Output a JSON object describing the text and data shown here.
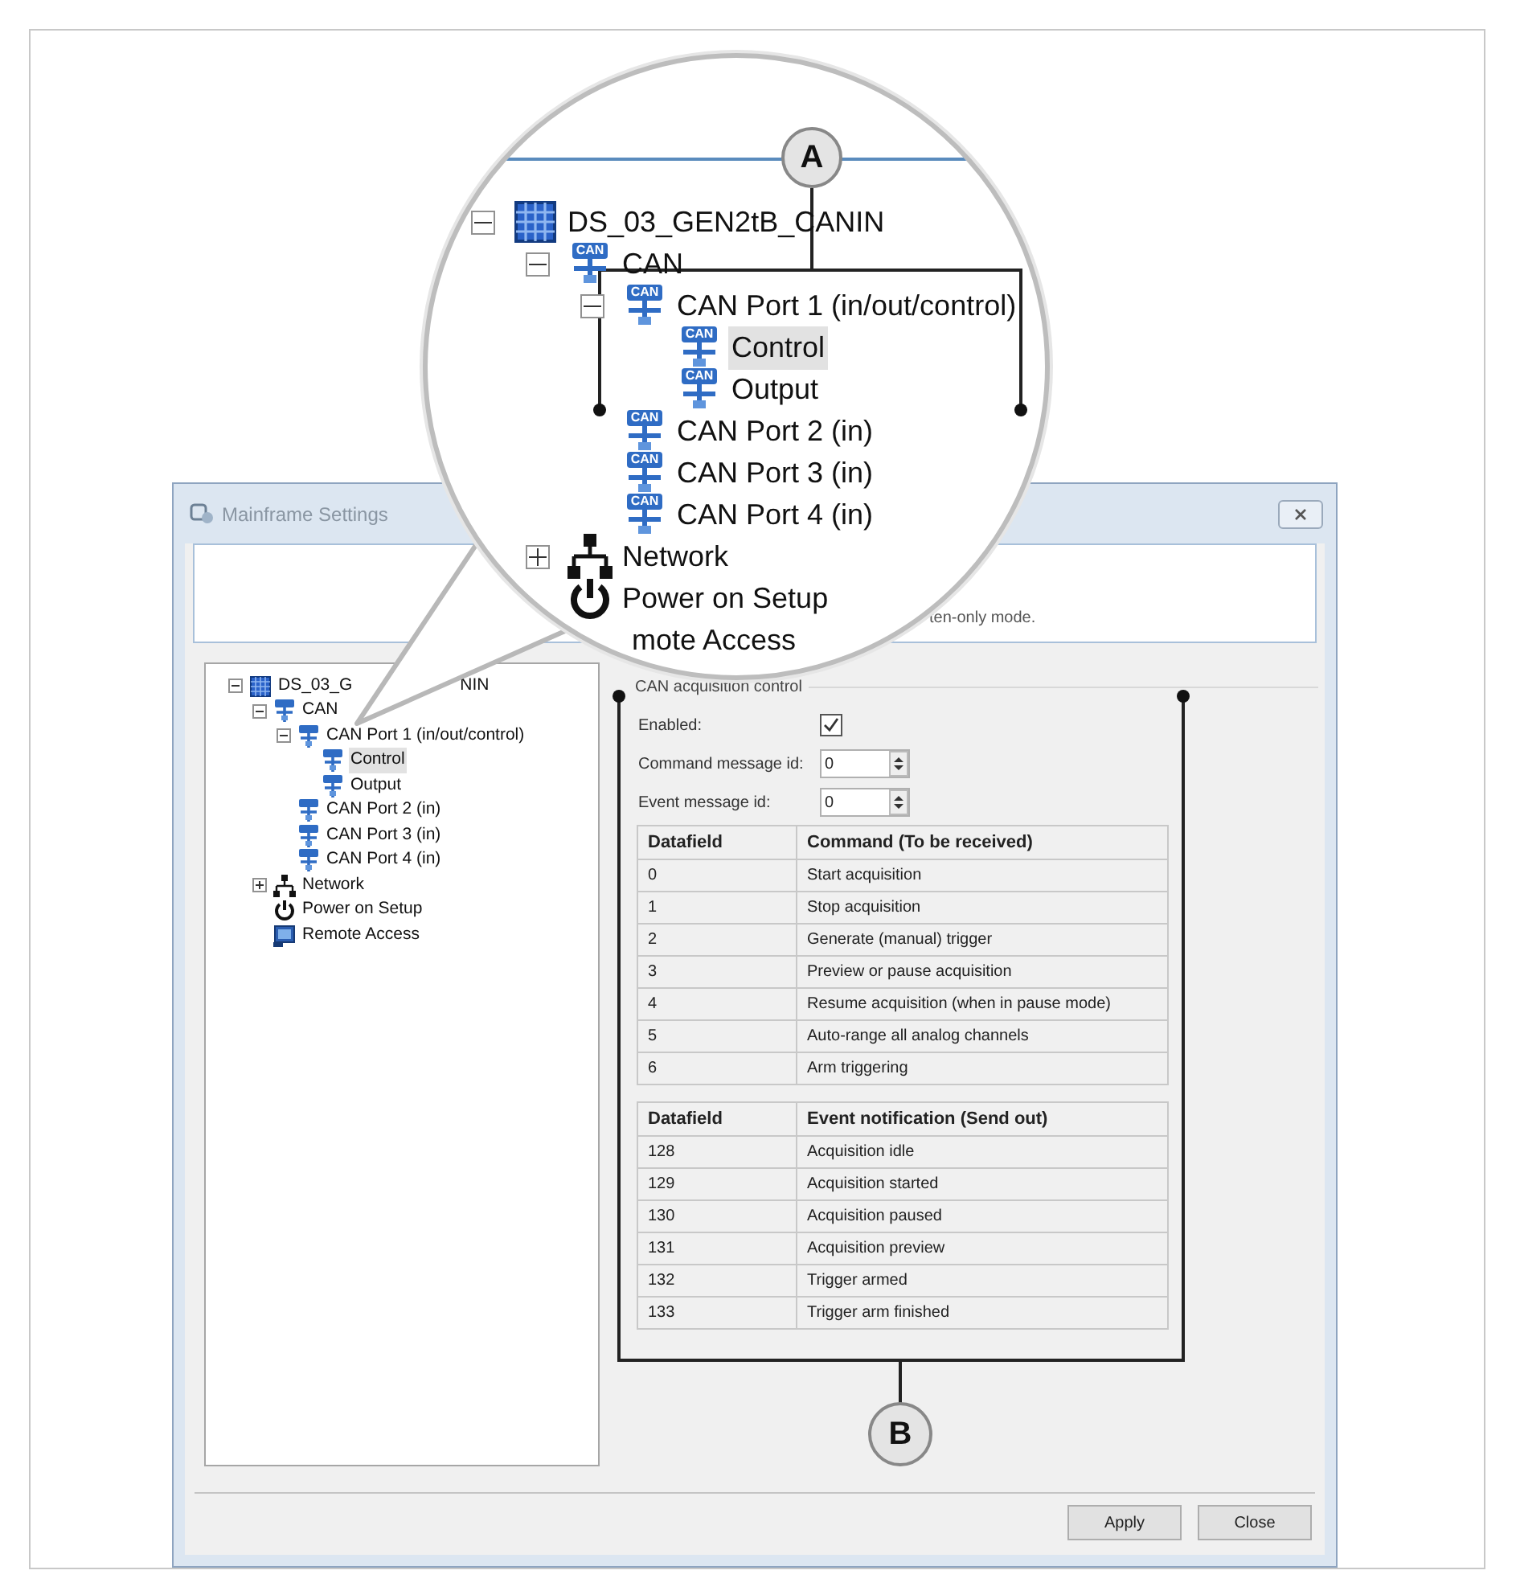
{
  "magnifier": {
    "marker": "A",
    "tree": [
      {
        "label": "DS_03_GEN2tB_CANIN",
        "kind": "device",
        "expanded": true,
        "selected": false,
        "children": [
          {
            "label": "CAN",
            "kind": "can",
            "badge": "CAN",
            "expanded": true,
            "selected": false,
            "children": [
              {
                "label": "CAN Port 1 (in/out/control)",
                "kind": "can",
                "badge": "CAN",
                "expanded": true,
                "selected": false,
                "children": [
                  {
                    "label": "Control",
                    "kind": "can",
                    "badge": "CAN",
                    "selected": true
                  },
                  {
                    "label": "Output",
                    "kind": "can",
                    "badge": "CAN",
                    "selected": false
                  }
                ]
              },
              {
                "label": "CAN Port 2 (in)",
                "kind": "can",
                "badge": "CAN",
                "selected": false
              },
              {
                "label": "CAN Port 3 (in)",
                "kind": "can",
                "badge": "CAN",
                "selected": false
              },
              {
                "label": "CAN Port 4 (in)",
                "kind": "can",
                "badge": "CAN",
                "selected": false
              }
            ]
          },
          {
            "label": "Network",
            "kind": "network",
            "expanded": false,
            "selected": false
          },
          {
            "label": "Power on Setup",
            "kind": "power",
            "selected": false
          },
          {
            "label": "mote Access",
            "kind": "cut",
            "selected": false
          }
        ]
      }
    ]
  },
  "dialog": {
    "title": "Mainframe Settings",
    "info_text": "ten-only mode.",
    "tree": [
      {
        "label": "DS_03_G",
        "label_end": "NIN",
        "kind": "device",
        "expanded": true,
        "selected": false,
        "children": [
          {
            "label": "CAN",
            "kind": "can",
            "expanded": true,
            "selected": false,
            "children": [
              {
                "label": "CAN Port 1 (in/out/control)",
                "kind": "can",
                "expanded": true,
                "selected": false,
                "children": [
                  {
                    "label": "Control",
                    "kind": "can",
                    "selected": true
                  },
                  {
                    "label": "Output",
                    "kind": "can",
                    "selected": false
                  }
                ]
              },
              {
                "label": "CAN Port 2 (in)",
                "kind": "can",
                "selected": false
              },
              {
                "label": "CAN Port 3 (in)",
                "kind": "can",
                "selected": false
              },
              {
                "label": "CAN Port 4 (in)",
                "kind": "can",
                "selected": false
              }
            ]
          },
          {
            "label": "Network",
            "kind": "network",
            "expanded": false,
            "selected": false
          },
          {
            "label": "Power on Setup",
            "kind": "power",
            "selected": false
          },
          {
            "label": "Remote Access",
            "kind": "remote",
            "selected": false
          }
        ]
      }
    ],
    "group": {
      "title": "CAN acquisition control",
      "fields": [
        {
          "kind": "checkbox",
          "label": "Enabled:",
          "checked": true
        },
        {
          "kind": "spinner",
          "label": "Command message id:",
          "value": "0"
        },
        {
          "kind": "spinner",
          "label": "Event message id:",
          "value": "0"
        }
      ]
    },
    "tables": [
      {
        "columns": [
          "Datafield",
          "Command (To be received)"
        ],
        "rows": [
          [
            "0",
            "Start acquisition"
          ],
          [
            "1",
            "Stop acquisition"
          ],
          [
            "2",
            "Generate (manual) trigger"
          ],
          [
            "3",
            "Preview or pause acquisition"
          ],
          [
            "4",
            "Resume acquisition (when in pause mode)"
          ],
          [
            "5",
            "Auto-range all analog channels"
          ],
          [
            "6",
            "Arm triggering"
          ]
        ]
      },
      {
        "columns": [
          "Datafield",
          "Event notification (Send out)"
        ],
        "rows": [
          [
            "128",
            "Acquisition idle"
          ],
          [
            "129",
            "Acquisition started"
          ],
          [
            "130",
            "Acquisition paused"
          ],
          [
            "131",
            "Acquisition preview"
          ],
          [
            "132",
            "Trigger armed"
          ],
          [
            "133",
            "Trigger arm finished"
          ]
        ]
      }
    ],
    "buttons": [
      "Apply",
      "Close"
    ]
  },
  "callout_b": {
    "marker": "B"
  }
}
